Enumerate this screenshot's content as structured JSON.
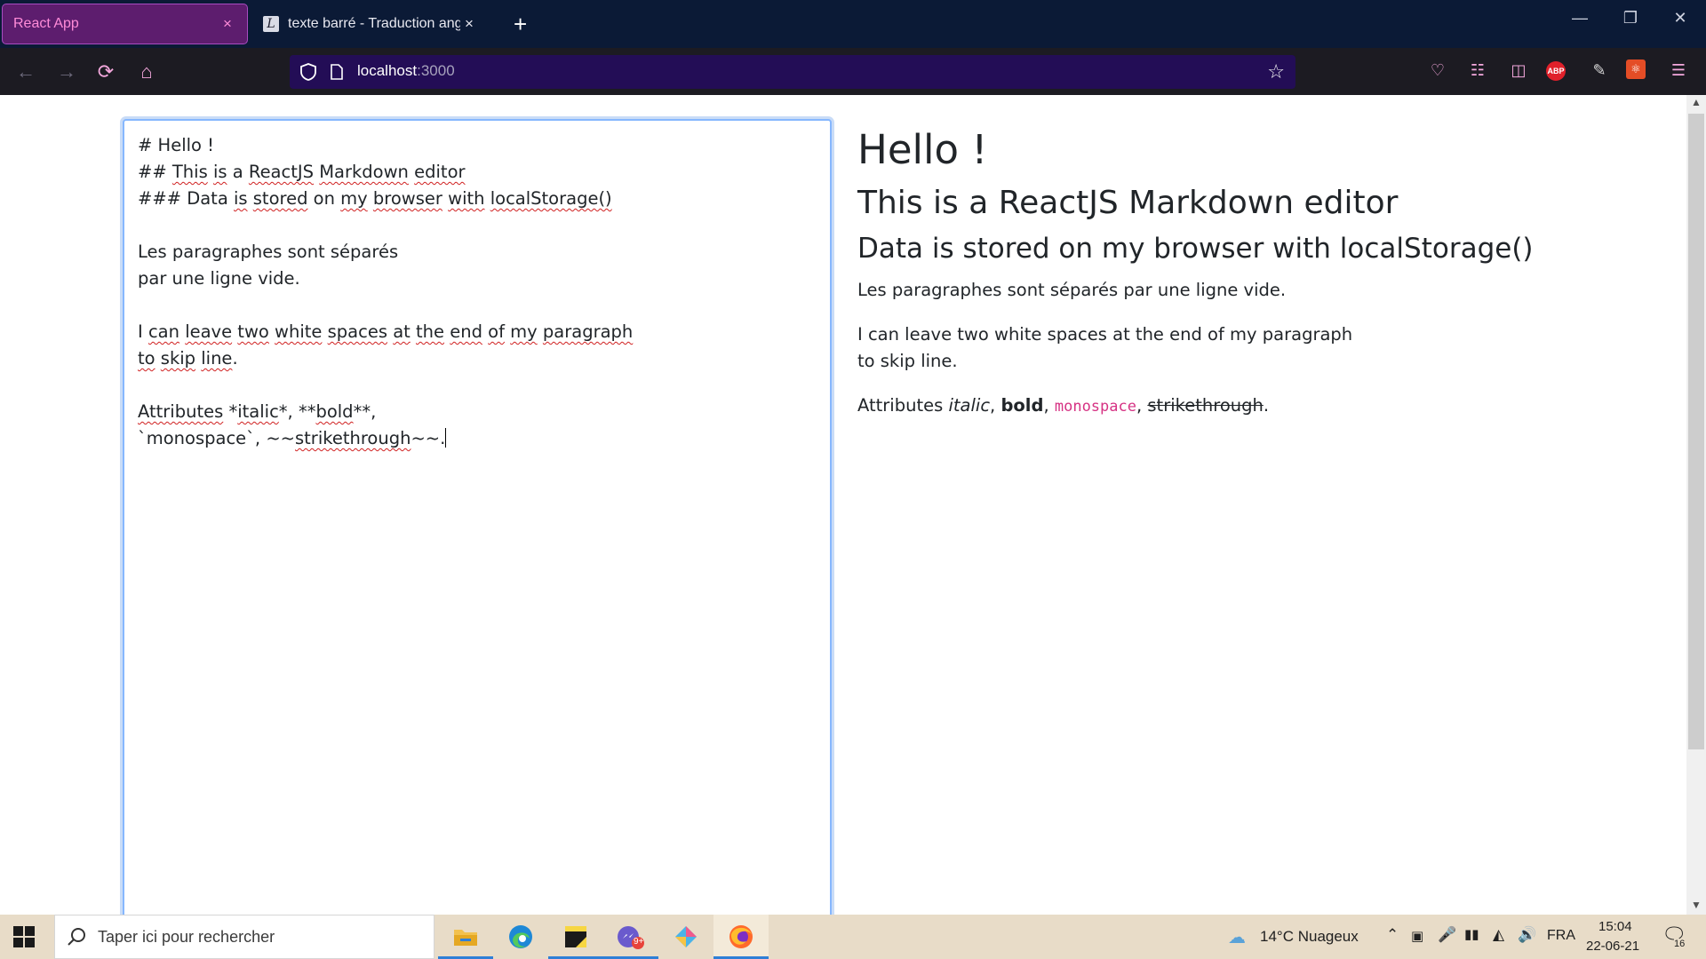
{
  "browser": {
    "tabs": [
      {
        "title": "React App",
        "close": "×"
      },
      {
        "title": "texte barré - Traduction anglaise",
        "close": "×"
      }
    ],
    "new_tab": "+",
    "url_host": "localhost",
    "url_port": ":3000",
    "abp_badge": "ABP"
  },
  "editor": {
    "lines": [
      "# Hello !",
      "## This is a ReactJS Markdown editor",
      "### Data is stored on my browser with localStorage()",
      "",
      "Les paragraphes sont séparés",
      "par une ligne vide.",
      "",
      "I can leave two white spaces at the end of my paragraph",
      "to skip line.",
      "",
      "Attributes *italic*, **bold**,",
      "`monospace`, ~~strikethrough~~."
    ]
  },
  "preview": {
    "h1": "Hello !",
    "h2": "This is a ReactJS Markdown editor",
    "h3": "Data is stored on my browser with localStorage()",
    "p1": "Les paragraphes sont séparés par une ligne vide.",
    "p2_line1": "I can leave two white spaces at the end of my paragraph",
    "p2_line2": "to skip line.",
    "attr_prefix": "Attributes ",
    "italic": "italic",
    "bold": "bold",
    "monospace": "monospace",
    "strikethrough": "strikethrough",
    "sep": ", ",
    "end": "."
  },
  "taskbar": {
    "search_placeholder": "Taper ici pour rechercher",
    "weather": "14°C  Nuageux",
    "language": "FRA",
    "time": "15:04",
    "date": "22-06-21",
    "notification_count": "16",
    "badge_count": "9+"
  },
  "colors": {
    "tab_bar": "#0b1a36",
    "active_tab": "#5d1d6e",
    "urlbar": "#230d56",
    "focus_ring": "#86b7fe",
    "code": "#d63384"
  }
}
